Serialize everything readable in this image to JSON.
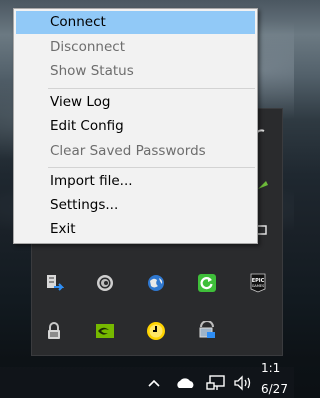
{
  "context_menu": {
    "items": [
      {
        "label": "Connect",
        "state": "highlighted"
      },
      {
        "label": "Disconnect",
        "state": "disabled"
      },
      {
        "label": "Show Status",
        "state": "disabled"
      },
      {
        "label": "View Log",
        "state": "enabled"
      },
      {
        "label": "Edit Config",
        "state": "enabled"
      },
      {
        "label": "Clear Saved Passwords",
        "state": "disabled"
      },
      {
        "label": "Import file...",
        "state": "enabled"
      },
      {
        "label": "Settings...",
        "state": "enabled"
      },
      {
        "label": "Exit",
        "state": "enabled"
      }
    ]
  },
  "tray_overflow": {
    "icons": [
      {
        "name": "network-transfer-icon"
      },
      {
        "name": "spiral-app-icon"
      },
      {
        "name": "globe-app-icon"
      },
      {
        "name": "green-refresh-icon"
      },
      {
        "name": "epic-games-icon",
        "text": "EPIC\nGAMES"
      },
      {
        "name": "openvpn-lock-icon"
      },
      {
        "name": "nvidia-icon"
      },
      {
        "name": "yellow-clock-icon"
      },
      {
        "name": "display-network-icon"
      }
    ]
  },
  "taskbar": {
    "icons": [
      "chevron-up-icon",
      "onedrive-cloud-icon",
      "network-icon",
      "volume-icon"
    ],
    "clock": {
      "time": "1:1",
      "date": "6/27"
    }
  },
  "colors": {
    "menu_background": "#f2f2f2",
    "menu_highlight": "#91c9f7",
    "menu_disabled_text": "#6d6d6d",
    "tray_panel": "#2a2b2d"
  }
}
